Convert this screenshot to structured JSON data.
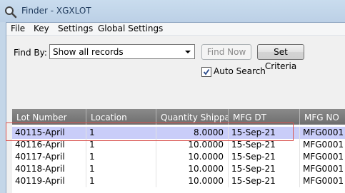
{
  "window": {
    "title": "Finder - XGXLOT"
  },
  "menu": [
    "File",
    "Key",
    "Settings",
    "Global Settings"
  ],
  "find": {
    "label": "Find By:",
    "selected_option": "Show all records",
    "find_now_label": "Find Now",
    "set_criteria_label": "Set Criteria",
    "auto_search_label": "Auto Search",
    "auto_search_checked": true
  },
  "grid": {
    "columns": [
      "Lot Number",
      "Location",
      "Quantity Shippa…",
      "MFG DT",
      "MFG NO"
    ],
    "rows": [
      {
        "lot": "40115-April",
        "location": "1",
        "qty": "8.0000",
        "mfg_dt": "15-Sep-21",
        "mfg_no": "MFG0001",
        "selected": true
      },
      {
        "lot": "40116-April",
        "location": "1",
        "qty": "10.0000",
        "mfg_dt": "15-Sep-21",
        "mfg_no": "MFG0001",
        "selected": false
      },
      {
        "lot": "40117-April",
        "location": "1",
        "qty": "10.0000",
        "mfg_dt": "15-Sep-21",
        "mfg_no": "MFG0001",
        "selected": false
      },
      {
        "lot": "40118-April",
        "location": "1",
        "qty": "10.0000",
        "mfg_dt": "15-Sep-21",
        "mfg_no": "MFG0001",
        "selected": false
      },
      {
        "lot": "40119-April",
        "location": "1",
        "qty": "10.0000",
        "mfg_dt": "15-Sep-21",
        "mfg_no": "MFG0001",
        "selected": false
      }
    ]
  }
}
